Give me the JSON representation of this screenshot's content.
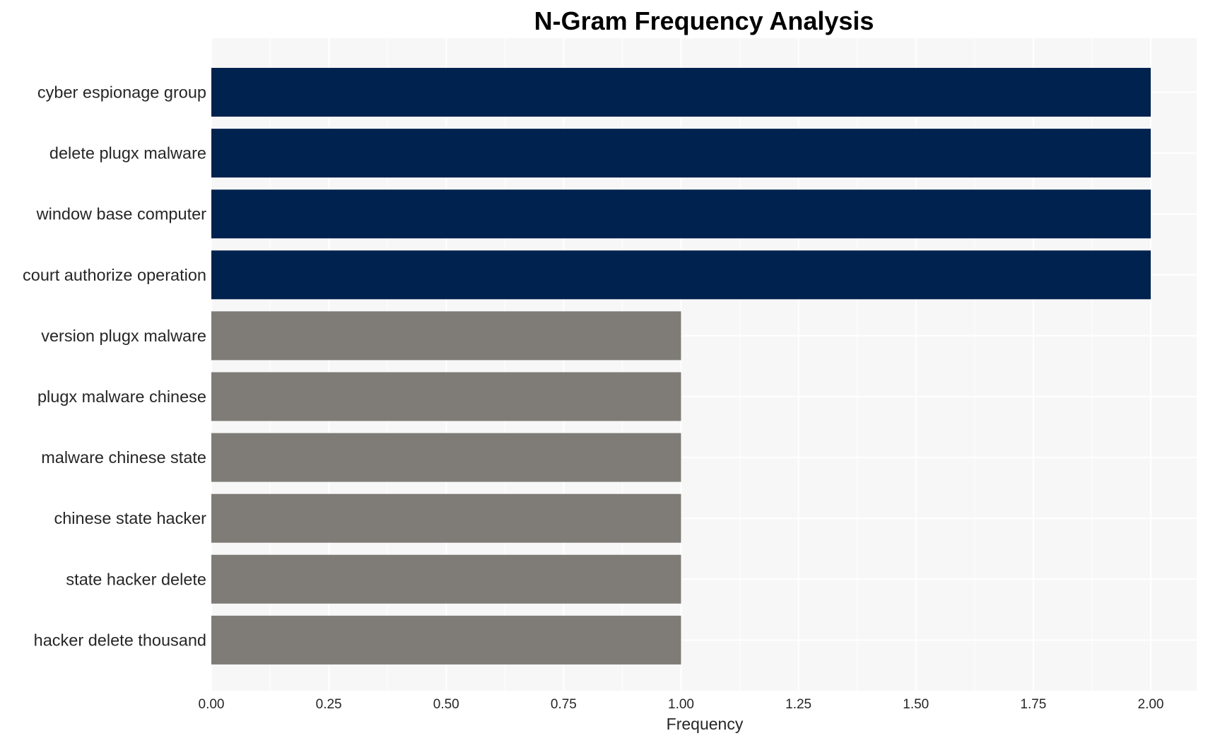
{
  "chart_data": {
    "type": "bar",
    "orientation": "horizontal",
    "title": "N-Gram Frequency Analysis",
    "xlabel": "Frequency",
    "ylabel": "",
    "categories": [
      "cyber espionage group",
      "delete plugx malware",
      "window base computer",
      "court authorize operation",
      "version plugx malware",
      "plugx malware chinese",
      "malware chinese state",
      "chinese state hacker",
      "state hacker delete",
      "hacker delete thousand"
    ],
    "values": [
      2,
      2,
      2,
      2,
      1,
      1,
      1,
      1,
      1,
      1
    ],
    "bar_colors": [
      "#00224e",
      "#00224e",
      "#00224e",
      "#00224e",
      "#7f7c77",
      "#7f7c77",
      "#7f7c77",
      "#7f7c77",
      "#7f7c77",
      "#7f7c77"
    ],
    "xlim": [
      0,
      2.1
    ],
    "xticks": [
      0,
      0.25,
      0.5,
      0.75,
      1.0,
      1.25,
      1.5,
      1.75,
      2.0
    ],
    "xtick_labels": [
      "0.00",
      "0.25",
      "0.50",
      "0.75",
      "1.00",
      "1.25",
      "1.50",
      "1.75",
      "2.00"
    ],
    "grid": true,
    "legend": "none",
    "colors": {
      "panel_background": "#f7f7f7",
      "grid": "#ffffff",
      "highlight": "#00224e",
      "default": "#7f7c77"
    }
  }
}
